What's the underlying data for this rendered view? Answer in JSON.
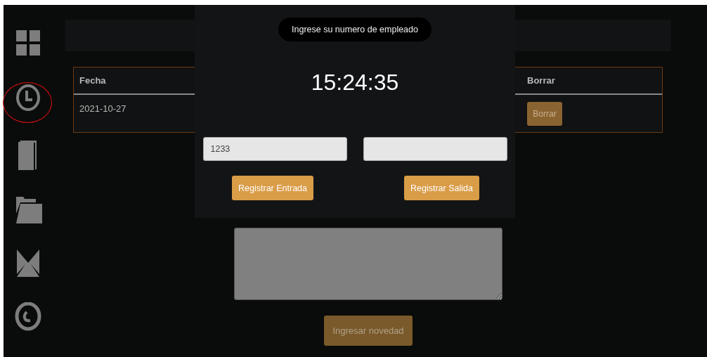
{
  "sidebar": {
    "items": [
      {
        "kind": "grid",
        "highlighted": false
      },
      {
        "kind": "clock",
        "highlighted": true
      },
      {
        "kind": "book",
        "highlighted": false
      },
      {
        "kind": "folder",
        "highlighted": false
      },
      {
        "kind": "mail",
        "highlighted": false
      },
      {
        "kind": "eye",
        "highlighted": false
      }
    ]
  },
  "table": {
    "columns": [
      "Fecha",
      "Borrar"
    ],
    "rows": [
      {
        "fecha": "2021-10-27",
        "delete_button": "Borrar"
      }
    ]
  },
  "novedad": {
    "submit_button": "Ingresar novedad",
    "submit_disabled": true
  },
  "modal": {
    "prompt": "Ingrese su numero de empleado",
    "clock": "15:24:35",
    "fields": [
      {
        "kind": "text",
        "value": "1233"
      },
      {
        "kind": "text"
      }
    ],
    "buttons": [
      "Registrar Entrada",
      "Registrar Salida"
    ]
  }
}
